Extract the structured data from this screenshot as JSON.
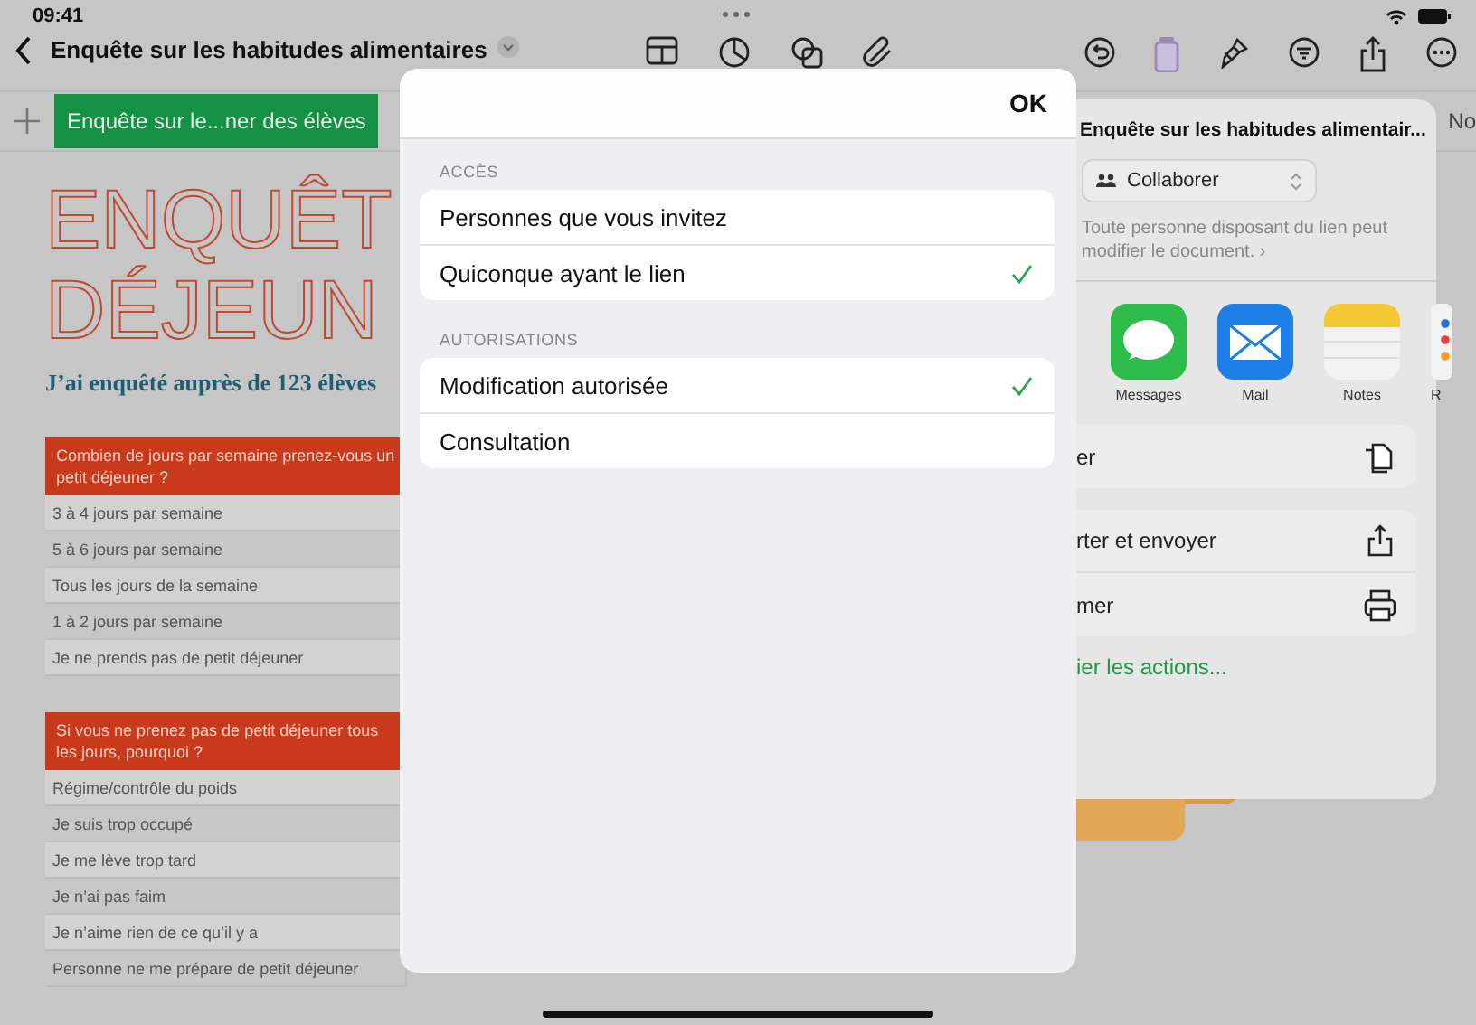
{
  "status_bar": {
    "time": "09:41"
  },
  "nav": {
    "title": "Enquête sur les habitudes alimentaires"
  },
  "sheet_tabs": [
    {
      "label": "Enquête sur le...ner des élèves",
      "selected": true
    },
    {
      "label": "No",
      "selected": false
    }
  ],
  "document": {
    "title_lines": [
      "ENQUÊT",
      "DÉJEUN"
    ],
    "subtitle": "J’ai enquêté auprès de 123 élèves",
    "tables": [
      {
        "header": "Combien de jours par semaine prenez-vous un petit déjeuner ?",
        "rows": [
          "3 à 4 jours par semaine",
          "5 à 6 jours par semaine",
          "Tous les jours de la semaine",
          "1 à 2 jours par semaine",
          "Je ne prends pas de petit déjeuner"
        ]
      },
      {
        "header": "Si vous ne prenez pas de petit déjeuner tous les jours, pourquoi ?",
        "rows": [
          "Régime/contrôle du poids",
          "Je suis trop occupé",
          "Je me lève trop tard",
          "Je n’ai pas faim",
          "Je n’aime rien de ce qu’il y a",
          "Personne ne me prépare de petit déjeuner"
        ]
      }
    ]
  },
  "share_sheet": {
    "title": "Enquête sur les habitudes alimentair...",
    "mode": "Collaborer",
    "description": "Toute personne disposant du lien peut modifier le document. ›",
    "apps": [
      {
        "label": "Messages",
        "kind": "messages"
      },
      {
        "label": "Mail",
        "kind": "mail"
      },
      {
        "label": "Notes",
        "kind": "notes"
      },
      {
        "label": "R",
        "kind": "reminders"
      }
    ],
    "action_groups": [
      [
        {
          "label": "er",
          "kind": "copy"
        }
      ],
      [
        {
          "label": "rter et envoyer",
          "kind": "export"
        },
        {
          "label": "mer",
          "kind": "print"
        }
      ]
    ],
    "edit_actions": "ier les actions..."
  },
  "modal": {
    "done": "OK",
    "sections": [
      {
        "header": "ACCÈS",
        "options": [
          {
            "label": "Personnes que vous invitez",
            "selected": false
          },
          {
            "label": "Quiconque ayant le lien",
            "selected": true
          }
        ]
      },
      {
        "header": "AUTORISATIONS",
        "options": [
          {
            "label": "Modification autorisée",
            "selected": true
          },
          {
            "label": "Consultation",
            "selected": false
          }
        ]
      }
    ]
  }
}
